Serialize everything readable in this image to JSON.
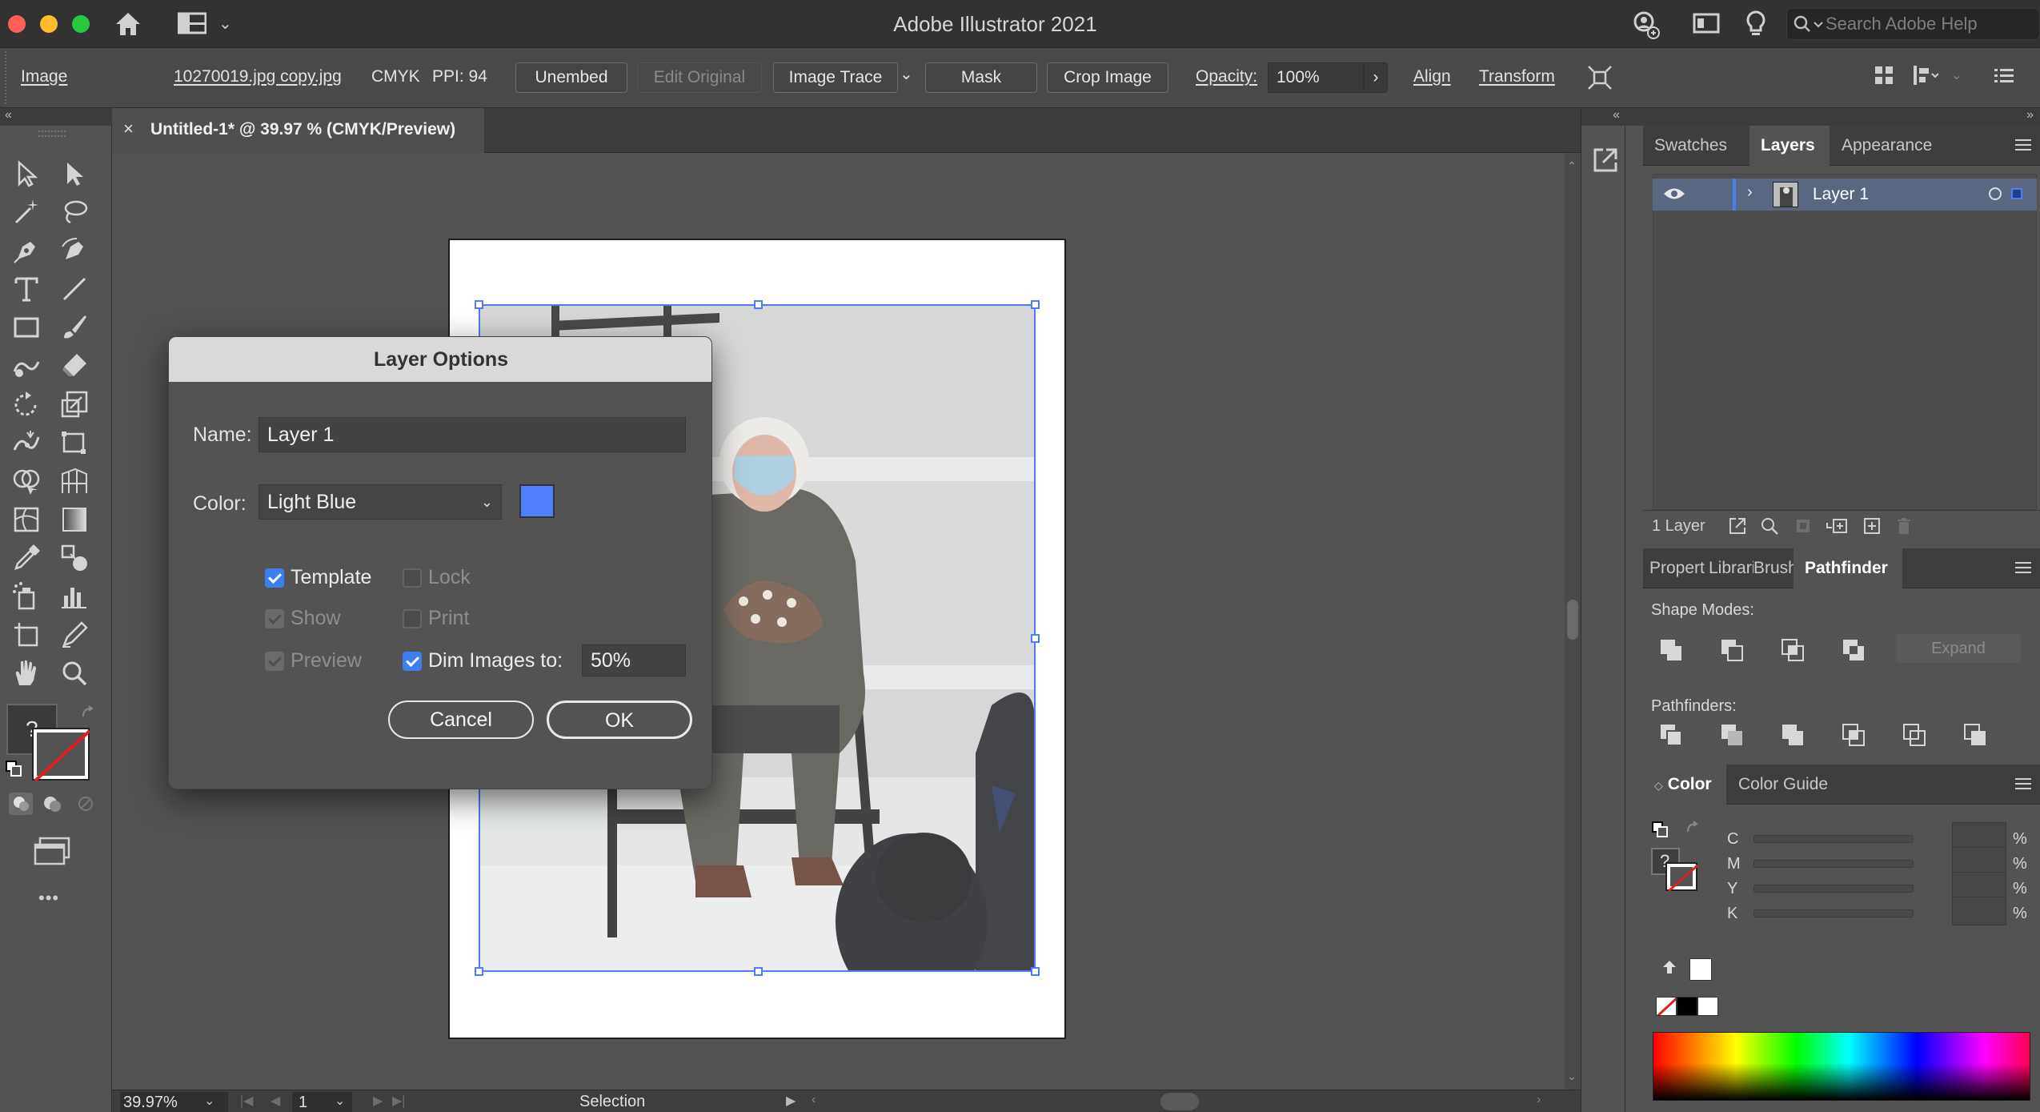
{
  "window": {
    "title": "Adobe Illustrator 2021",
    "search_placeholder": "Search Adobe Help"
  },
  "control_bar": {
    "selection_type": "Image",
    "filename": "10270019.jpg copy.jpg",
    "color_mode": "CMYK",
    "ppi": "PPI: 94",
    "unembed": "Unembed",
    "edit_original": "Edit Original",
    "image_trace": "Image Trace",
    "mask": "Mask",
    "crop_image": "Crop Image",
    "opacity_label": "Opacity:",
    "opacity_value": "100%",
    "align": "Align",
    "transform": "Transform"
  },
  "document": {
    "tab_title": "Untitled-1* @ 39.97 % (CMYK/Preview)"
  },
  "status_bar": {
    "zoom": "39.97%",
    "artboard_number": "1",
    "tool_mode": "Selection"
  },
  "layers_panel": {
    "tabs": [
      "Swatches",
      "Layers",
      "Appearance"
    ],
    "active_tab": "Layers",
    "layers": [
      {
        "name": "Layer 1",
        "color": "#4d7df2"
      }
    ],
    "count": "1 Layer"
  },
  "pathfinder_panel": {
    "tabs": [
      "Propert",
      "Librarie",
      "Brushe",
      "Pathfinder"
    ],
    "active_tab": "Pathfinder",
    "shape_modes_label": "Shape Modes:",
    "expand_label": "Expand",
    "pathfinders_label": "Pathfinders:"
  },
  "color_panel": {
    "tabs": [
      "Color",
      "Color Guide"
    ],
    "active_tab": "Color",
    "channels": [
      {
        "label": "C",
        "unit": "%"
      },
      {
        "label": "M",
        "unit": "%"
      },
      {
        "label": "Y",
        "unit": "%"
      },
      {
        "label": "K",
        "unit": "%"
      }
    ],
    "question_mark": "?"
  },
  "toolbar": {
    "fill_stroke_question": "?",
    "more_tools": "•••"
  },
  "dialog": {
    "title": "Layer Options",
    "name_label": "Name:",
    "name_value": "Layer 1",
    "color_label": "Color:",
    "color_value": "Light Blue",
    "swatch_color": "#4f7fff",
    "template_label": "Template",
    "template_checked": true,
    "lock_label": "Lock",
    "lock_checked": false,
    "show_label": "Show",
    "show_checked": true,
    "print_label": "Print",
    "print_checked": false,
    "preview_label": "Preview",
    "preview_checked": true,
    "dim_images_label": "Dim Images to:",
    "dim_images_checked": true,
    "dim_images_value": "50%",
    "cancel_label": "Cancel",
    "ok_label": "OK"
  },
  "colors": {
    "selection_accent": "#4d7df2",
    "checkbox_accent": "#3c80f0",
    "ui_background": "#535353"
  }
}
